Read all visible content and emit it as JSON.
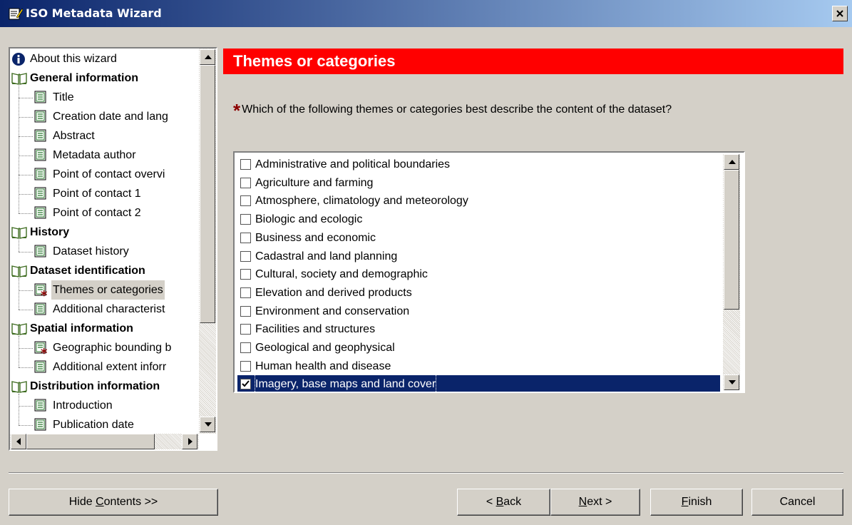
{
  "window": {
    "title": "ISO Metadata Wizard",
    "close_glyph": "×"
  },
  "colors": {
    "title_start": "#0a246a",
    "title_end": "#a6caf0",
    "header_bg": "#ff0000",
    "selection": "#0a246a",
    "required_star": "#8b0000"
  },
  "tree": {
    "nodes": [
      {
        "label": "About this wizard",
        "type": "info",
        "icon": "info-icon"
      },
      {
        "label": "General information",
        "type": "group",
        "icon": "book-icon"
      },
      {
        "label": "Title",
        "type": "page",
        "icon": "page-icon"
      },
      {
        "label": "Creation date and lang",
        "type": "page",
        "icon": "page-icon"
      },
      {
        "label": "Abstract",
        "type": "page",
        "icon": "page-icon"
      },
      {
        "label": "Metadata author",
        "type": "page",
        "icon": "page-icon"
      },
      {
        "label": "Point of contact overvi",
        "type": "page",
        "icon": "page-icon"
      },
      {
        "label": "Point of contact 1",
        "type": "page",
        "icon": "page-icon"
      },
      {
        "label": "Point of contact 2",
        "type": "page",
        "icon": "page-icon"
      },
      {
        "label": "History",
        "type": "group",
        "icon": "book-icon"
      },
      {
        "label": "Dataset history",
        "type": "page",
        "icon": "page-icon"
      },
      {
        "label": "Dataset identification",
        "type": "group",
        "icon": "book-icon"
      },
      {
        "label": "Themes or categories",
        "type": "page-required",
        "icon": "required-page-icon",
        "selected": true
      },
      {
        "label": "Additional characterist",
        "type": "page",
        "icon": "page-icon"
      },
      {
        "label": "Spatial information",
        "type": "group",
        "icon": "book-icon"
      },
      {
        "label": "Geographic bounding b",
        "type": "page-required",
        "icon": "required-page-icon"
      },
      {
        "label": "Additional extent inforr",
        "type": "page",
        "icon": "page-icon"
      },
      {
        "label": "Distribution information",
        "type": "group",
        "icon": "book-icon"
      },
      {
        "label": "Introduction",
        "type": "page",
        "icon": "page-icon"
      },
      {
        "label": "Publication date",
        "type": "page",
        "icon": "page-icon"
      }
    ]
  },
  "main": {
    "header": "Themes or categories",
    "required_marker": "*",
    "question": "Which of the following themes or categories best describe the content of the dataset?",
    "options": [
      {
        "label": "Administrative and political boundaries",
        "checked": false
      },
      {
        "label": "Agriculture and farming",
        "checked": false
      },
      {
        "label": "Atmosphere, climatology and meteorology",
        "checked": false
      },
      {
        "label": "Biologic and ecologic",
        "checked": false
      },
      {
        "label": "Business and economic",
        "checked": false
      },
      {
        "label": "Cadastral and land planning",
        "checked": false
      },
      {
        "label": "Cultural, society and demographic",
        "checked": false
      },
      {
        "label": "Elevation and derived products",
        "checked": false
      },
      {
        "label": "Environment and conservation",
        "checked": false
      },
      {
        "label": "Facilities and structures",
        "checked": false
      },
      {
        "label": "Geological and geophysical",
        "checked": false
      },
      {
        "label": "Human health and disease",
        "checked": false
      },
      {
        "label": "Imagery, base maps and land cover",
        "checked": true,
        "selected": true
      }
    ]
  },
  "buttons": {
    "hide_contents": {
      "pre": "Hide ",
      "key": "C",
      "post": "ontents >>"
    },
    "back": {
      "pre": "< ",
      "key": "B",
      "post": "ack"
    },
    "next": {
      "pre": "",
      "key": "N",
      "post": "ext >"
    },
    "finish": {
      "pre": "",
      "key": "F",
      "post": "inish"
    },
    "cancel": {
      "pre": "Cancel",
      "key": "",
      "post": ""
    }
  }
}
